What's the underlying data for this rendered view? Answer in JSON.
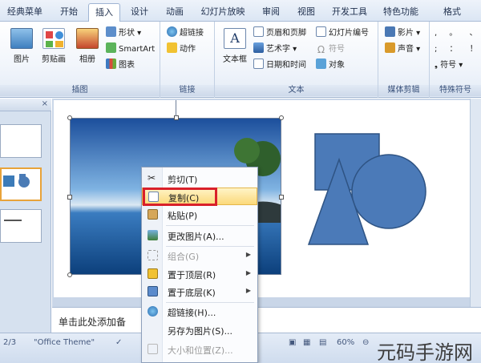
{
  "tabs": [
    "经典菜单",
    "开始",
    "插入",
    "设计",
    "动画",
    "幻灯片放映",
    "审阅",
    "视图",
    "开发工具",
    "特色功能",
    "格式"
  ],
  "active_tab": "插入",
  "ribbon": {
    "groups": {
      "images": {
        "label": "插图",
        "picture": "图片",
        "clipart": "剪贴画",
        "album": "相册",
        "shapes": "形状",
        "smartart": "SmartArt",
        "chart": "图表"
      },
      "links": {
        "label": "链接",
        "hyperlink": "超链接",
        "action": "动作"
      },
      "text": {
        "label": "文本",
        "textbox": "文本框",
        "header_footer": "页眉和页脚",
        "wordart": "艺术字",
        "datetime": "日期和时间",
        "slide_number": "幻灯片编号",
        "symbol": "符号",
        "object": "对象"
      },
      "media": {
        "label": "媒体剪辑",
        "movie": "影片",
        "sound": "声音"
      },
      "special": {
        "label": "特殊符号",
        "symbol": "符号"
      }
    }
  },
  "notes_placeholder": "单击此处添加备",
  "status": {
    "slide": "2/3",
    "theme": "\"Office Theme\"",
    "zoom": "60%"
  },
  "context_menu": {
    "items": [
      {
        "label": "剪切(T)",
        "icon": "scissors-icon",
        "disabled": false
      },
      {
        "label": "复制(C)",
        "icon": "copy-icon",
        "disabled": false
      },
      {
        "label": "粘贴(P)",
        "icon": "paste-icon",
        "disabled": false
      },
      {
        "label": "更改图片(A)...",
        "icon": "change-picture-icon",
        "disabled": false
      },
      {
        "label": "组合(G)",
        "icon": "group-icon",
        "disabled": true
      },
      {
        "label": "置于顶层(R)",
        "icon": "bring-front-icon",
        "disabled": false
      },
      {
        "label": "置于底层(K)",
        "icon": "send-back-icon",
        "disabled": false
      },
      {
        "label": "超链接(H)...",
        "icon": "hyperlink-icon",
        "disabled": false
      },
      {
        "label": "另存为图片(S)...",
        "icon": "save-picture-icon",
        "disabled": false
      },
      {
        "label": "大小和位置(Z)...",
        "icon": "size-position-icon",
        "disabled": true
      }
    ],
    "highlighted": "复制(C)"
  },
  "watermark": "元码手游网"
}
